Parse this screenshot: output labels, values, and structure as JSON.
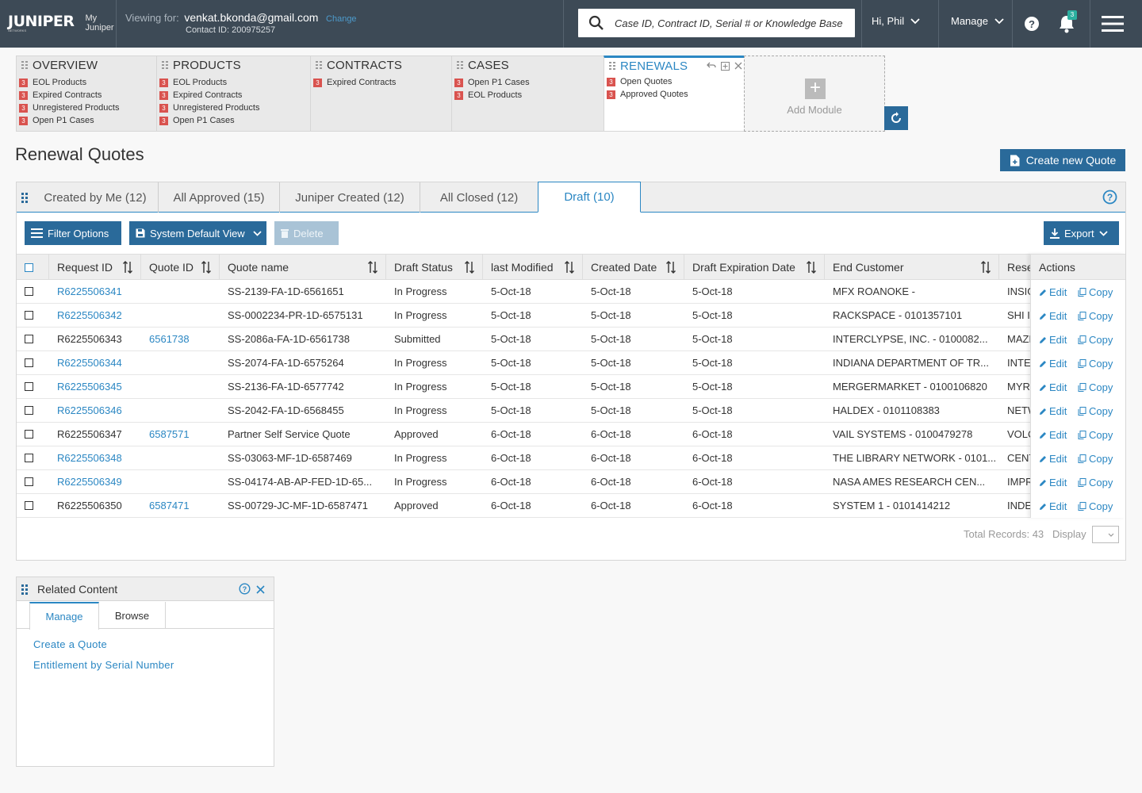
{
  "header": {
    "logo_main": "JUNIPER",
    "logo_sub": "NETWORKS",
    "logo_my": "My",
    "logo_juniper": "Juniper",
    "viewing_label": "Viewing for:",
    "viewing_email": "venkat.bkonda@gmail.com",
    "change_label": "Change",
    "contact_id": "Contact ID: 200975257",
    "search_placeholder": "Case ID, Contract ID, Serial # or Knowledge Base",
    "user_greeting": "Hi, Phil",
    "manage_label": "Manage",
    "notification_count": "3"
  },
  "modules": [
    {
      "title": "OVERVIEW",
      "items": [
        {
          "count": "3",
          "label": "EOL Products"
        },
        {
          "count": "3",
          "label": "Expired Contracts"
        },
        {
          "count": "3",
          "label": "Unregistered Products"
        },
        {
          "count": "3",
          "label": "Open P1 Cases"
        }
      ]
    },
    {
      "title": "PRODUCTS",
      "items": [
        {
          "count": "3",
          "label": "EOL Products"
        },
        {
          "count": "3",
          "label": "Expired Contracts"
        },
        {
          "count": "3",
          "label": "Unregistered Products"
        },
        {
          "count": "3",
          "label": "Open P1 Cases"
        }
      ]
    },
    {
      "title": "CONTRACTS",
      "items": [
        {
          "count": "3",
          "label": "Expired Contracts"
        }
      ]
    },
    {
      "title": "CASES",
      "items": [
        {
          "count": "3",
          "label": "Open P1 Cases"
        },
        {
          "count": "3",
          "label": "EOL Products"
        }
      ]
    },
    {
      "title": "RENEWALS",
      "items": [
        {
          "count": "3",
          "label": "Open Quotes"
        },
        {
          "count": "3",
          "label": "Approved Quotes"
        }
      ]
    }
  ],
  "add_module_label": "Add Module",
  "page": {
    "title": "Renewal Quotes",
    "create_button": "Create new Quote"
  },
  "tabs": [
    {
      "label": "Created by Me (12)"
    },
    {
      "label": "All Approved (15)"
    },
    {
      "label": "Juniper Created (12)"
    },
    {
      "label": "All Closed (12)"
    },
    {
      "label": "Draft (10)"
    }
  ],
  "toolbar": {
    "filter_label": "Filter Options",
    "view_label": "System Default View",
    "delete_label": "Delete",
    "export_label": "Export"
  },
  "columns": [
    "Request ID",
    "Quote ID",
    "Quote name",
    "Draft Status",
    "last Modified",
    "Created Date",
    "Draft Expiration Date",
    "End Customer",
    "Rese",
    "Actions"
  ],
  "rows": [
    {
      "request_id": "R6225506341",
      "quote_id": "",
      "quote_name": "SS-2139-FA-1D-6561651",
      "status": "In Progress",
      "modified": "5-Oct-18",
      "created": "5-Oct-18",
      "expiration": "5-Oct-18",
      "end_customer": "MFX ROANOKE -",
      "reseller": "INSIG"
    },
    {
      "request_id": "R6225506342",
      "quote_id": "",
      "quote_name": "SS-0002234-PR-1D-6575131",
      "status": "In Progress",
      "modified": "5-Oct-18",
      "created": "5-Oct-18",
      "expiration": "5-Oct-18",
      "end_customer": "RACKSPACE - 0101357101",
      "reseller": "SHI IN"
    },
    {
      "request_id": "R6225506343",
      "quote_id": "6561738",
      "quote_name": "SS-2086a-FA-1D-6561738",
      "status": "Submitted",
      "modified": "5-Oct-18",
      "created": "5-Oct-18",
      "expiration": "5-Oct-18",
      "end_customer": "INTERCLYPSE, INC. - 0100082...",
      "reseller": "MAZD"
    },
    {
      "request_id": "R6225506344",
      "quote_id": "",
      "quote_name": "SS-2074-FA-1D-6575264",
      "status": "In Progress",
      "modified": "5-Oct-18",
      "created": "5-Oct-18",
      "expiration": "5-Oct-18",
      "end_customer": "INDIANA DEPARTMENT OF TR...",
      "reseller": "INTEC"
    },
    {
      "request_id": "R6225506345",
      "quote_id": "",
      "quote_name": "SS-2136-FA-1D-6577742",
      "status": "In Progress",
      "modified": "5-Oct-18",
      "created": "5-Oct-18",
      "expiration": "5-Oct-18",
      "end_customer": "MERGERMARKET - 0100106820",
      "reseller": "MYRI"
    },
    {
      "request_id": "R6225506346",
      "quote_id": "",
      "quote_name": "SS-2042-FA-1D-6568455",
      "status": "In Progress",
      "modified": "5-Oct-18",
      "created": "5-Oct-18",
      "expiration": "5-Oct-18",
      "end_customer": "HALDEX - 0101108383",
      "reseller": "NETW"
    },
    {
      "request_id": "R6225506347",
      "quote_id": "6587571",
      "quote_name": "Partner Self Service Quote",
      "status": "Approved",
      "modified": "6-Oct-18",
      "created": "6-Oct-18",
      "expiration": "6-Oct-18",
      "end_customer": "VAIL SYSTEMS - 0100479278",
      "reseller": "VOLC"
    },
    {
      "request_id": "R6225506348",
      "quote_id": "",
      "quote_name": "SS-03063-MF-1D-6587469",
      "status": "In Progress",
      "modified": "6-Oct-18",
      "created": "6-Oct-18",
      "expiration": "6-Oct-18",
      "end_customer": "THE LIBRARY NETWORK - 0101...",
      "reseller": "CENT"
    },
    {
      "request_id": "R6225506349",
      "quote_id": "",
      "quote_name": "SS-04174-AB-AP-FED-1D-65...",
      "status": "In Progress",
      "modified": "6-Oct-18",
      "created": "6-Oct-18",
      "expiration": "6-Oct-18",
      "end_customer": "NASA AMES RESEARCH CEN...",
      "reseller": "IMPR"
    },
    {
      "request_id": "R6225506350",
      "quote_id": "6587471",
      "quote_name": "SS-00729-JC-MF-1D-6587471",
      "status": "Approved",
      "modified": "6-Oct-18",
      "created": "6-Oct-18",
      "expiration": "6-Oct-18",
      "end_customer": "SYSTEM 1 - 0101414212",
      "reseller": "INDE"
    }
  ],
  "actions": {
    "edit": "Edit",
    "copy": "Copy"
  },
  "footer": {
    "total_records": "Total Records: 43",
    "display_label": "Display"
  },
  "related": {
    "title": "Related Content",
    "tabs": [
      "Manage",
      "Browse"
    ],
    "links": [
      "Create a Quote",
      "Entitlement by Serial Number"
    ]
  },
  "colors": {
    "header_bg": "#3d4a56",
    "accent": "#2b87c3",
    "button_dark": "#2a6a9a",
    "count_badge": "#d9534f"
  }
}
